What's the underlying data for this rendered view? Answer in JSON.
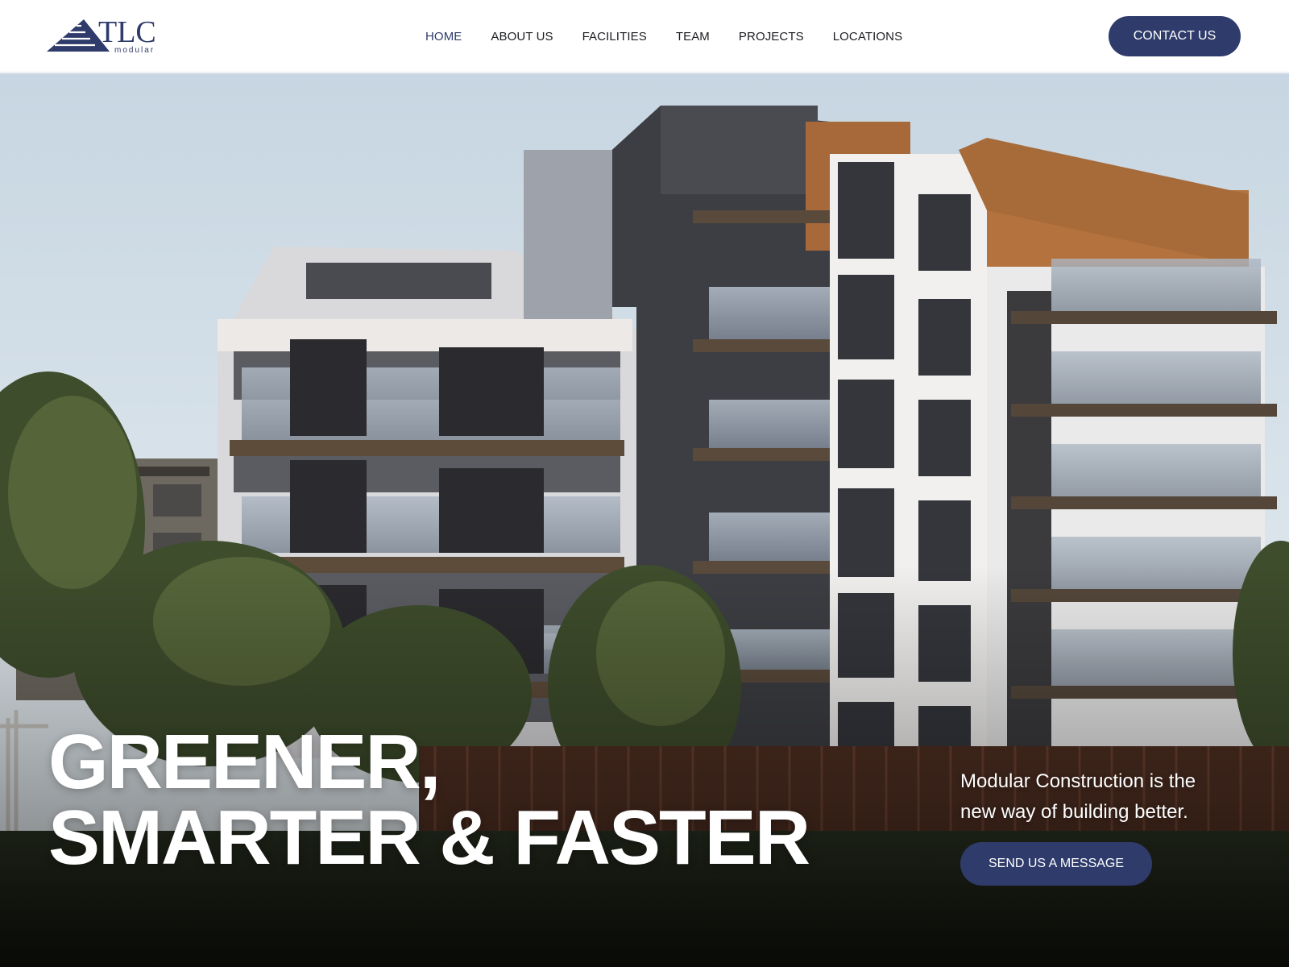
{
  "brand": {
    "name": "TLC",
    "tagline": "modular",
    "color": "#2f3b6b"
  },
  "nav": {
    "items": [
      {
        "label": "HOME",
        "active": true
      },
      {
        "label": "ABOUT US",
        "active": false
      },
      {
        "label": "FACILITIES",
        "active": false
      },
      {
        "label": "TEAM",
        "active": false
      },
      {
        "label": "PROJECTS",
        "active": false
      },
      {
        "label": "LOCATIONS",
        "active": false
      }
    ],
    "contact_label": "CONTACT US"
  },
  "hero": {
    "heading_line1": "GREENER,",
    "heading_line2": "SMARTER & FASTER",
    "subtext": "Modular Construction is the new way of building better.",
    "cta_label": "SEND US A MESSAGE",
    "image_subject": "modern multi-storey modular apartment building"
  },
  "colors": {
    "accent": "#2f3b6b",
    "text": "#1c1d22",
    "hero_text": "#ffffff"
  }
}
